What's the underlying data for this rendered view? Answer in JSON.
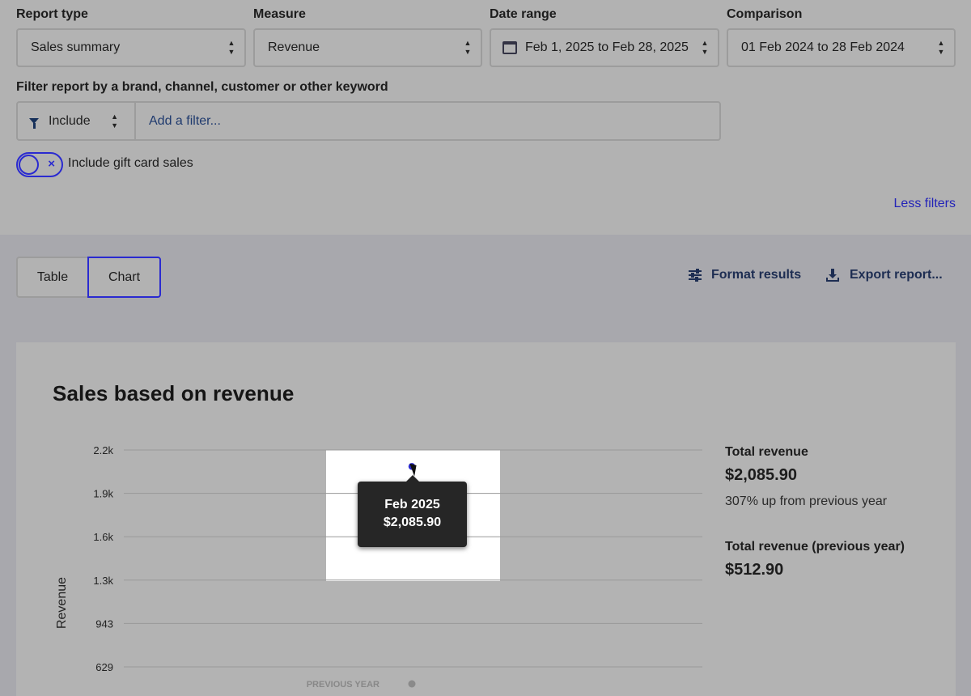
{
  "filters": {
    "report_type": {
      "label": "Report type",
      "value": "Sales summary"
    },
    "measure": {
      "label": "Measure",
      "value": "Revenue"
    },
    "date_range": {
      "label": "Date range",
      "value": "Feb 1, 2025 to Feb 28, 2025"
    },
    "comparison": {
      "label": "Comparison",
      "value": "01 Feb 2024 to 28 Feb 2024"
    },
    "keyword_filter": {
      "label": "Filter report by a brand, channel, customer or other keyword",
      "mode": "Include",
      "placeholder": "Add a filter..."
    },
    "gift_card_toggle": {
      "label": "Include gift card sales",
      "on": false
    },
    "less_filters_link": "Less filters"
  },
  "results": {
    "tabs": [
      {
        "label": "Table",
        "active": false
      },
      {
        "label": "Chart",
        "active": true
      }
    ],
    "actions": {
      "format": "Format results",
      "export": "Export report..."
    }
  },
  "card": {
    "title": "Sales based on revenue",
    "tooltip": {
      "period": "Feb 2025",
      "value": "$2,085.90"
    },
    "stats": {
      "total_label": "Total revenue",
      "total_value": "$2,085.90",
      "change_note": "307% up from previous year",
      "prev_label": "Total revenue (previous year)",
      "prev_value": "$512.90"
    }
  },
  "chart_data": {
    "type": "scatter",
    "ylabel": "Revenue",
    "y_ticks": [
      "2.2k",
      "1.9k",
      "1.6k",
      "1.3k",
      "943",
      "629"
    ],
    "y_tick_values": [
      2200,
      1900,
      1600,
      1300,
      943,
      629
    ],
    "series": [
      {
        "name": "Feb 2025",
        "x": [
          "Feb 2025"
        ],
        "values": [
          2085.9
        ],
        "color": "#2a2ad0"
      },
      {
        "name": "PREVIOUS YEAR",
        "x": [
          "Feb 2025"
        ],
        "values": [
          512.9
        ],
        "color": "#8a8a8a"
      }
    ],
    "legend": [
      "PREVIOUS YEAR"
    ],
    "grid": true
  }
}
